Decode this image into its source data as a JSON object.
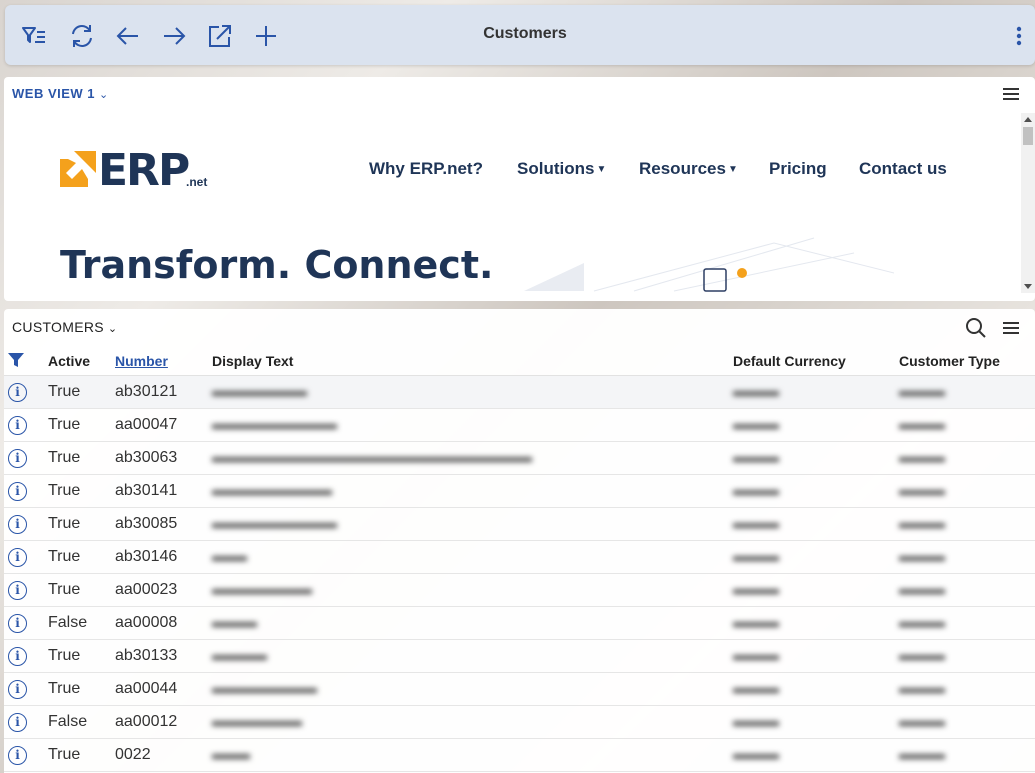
{
  "toolbar": {
    "title": "Customers",
    "buttons": [
      "filter-icon",
      "refresh-icon",
      "back-arrow-icon",
      "forward-arrow-icon",
      "open-external-icon",
      "add-icon"
    ],
    "more_icon": "more-vertical-icon"
  },
  "webview": {
    "header": "WEB VIEW 1",
    "site": {
      "logo_text": "ERP",
      "logo_suffix": ".net",
      "nav": [
        {
          "label": "Why ERP.net?",
          "dropdown": false
        },
        {
          "label": "Solutions",
          "dropdown": true
        },
        {
          "label": "Resources",
          "dropdown": true
        },
        {
          "label": "Pricing",
          "dropdown": false
        },
        {
          "label": "Contact us",
          "dropdown": false
        }
      ],
      "hero": "Transform. Connect."
    }
  },
  "customers": {
    "header": "CUSTOMERS",
    "columns": {
      "active": "Active",
      "number": "Number",
      "display": "Display Text",
      "currency": "Default Currency",
      "type": "Customer Type"
    },
    "rows": [
      {
        "active": "True",
        "number": "ab30121",
        "display": "blurred",
        "currency": "blurred",
        "type": "blurred"
      },
      {
        "active": "True",
        "number": "aa00047",
        "display": "blurred",
        "currency": "blurred",
        "type": "blurred"
      },
      {
        "active": "True",
        "number": "ab30063",
        "display": "blurred",
        "currency": "blurred",
        "type": "blurred"
      },
      {
        "active": "True",
        "number": "ab30141",
        "display": "blurred",
        "currency": "blurred",
        "type": "blurred"
      },
      {
        "active": "True",
        "number": "ab30085",
        "display": "blurred",
        "currency": "blurred",
        "type": "blurred"
      },
      {
        "active": "True",
        "number": "ab30146",
        "display": "blurred",
        "currency": "blurred",
        "type": "blurred"
      },
      {
        "active": "True",
        "number": "aa00023",
        "display": "blurred",
        "currency": "blurred",
        "type": "blurred"
      },
      {
        "active": "False",
        "number": "aa00008",
        "display": "blurred",
        "currency": "blurred",
        "type": "blurred"
      },
      {
        "active": "True",
        "number": "ab30133",
        "display": "blurred",
        "currency": "blurred",
        "type": "blurred"
      },
      {
        "active": "True",
        "number": "aa00044",
        "display": "blurred",
        "currency": "blurred",
        "type": "blurred"
      },
      {
        "active": "False",
        "number": "aa00012",
        "display": "blurred",
        "currency": "blurred",
        "type": "blurred"
      },
      {
        "active": "True",
        "number": "0022",
        "display": "blurred",
        "currency": "blurred",
        "type": "blurred"
      }
    ]
  },
  "colors": {
    "accent": "#2a55a8",
    "brand_dark": "#1f3557",
    "brand_orange": "#f4a11c",
    "toolbar_bg": "#dbe3ef"
  }
}
